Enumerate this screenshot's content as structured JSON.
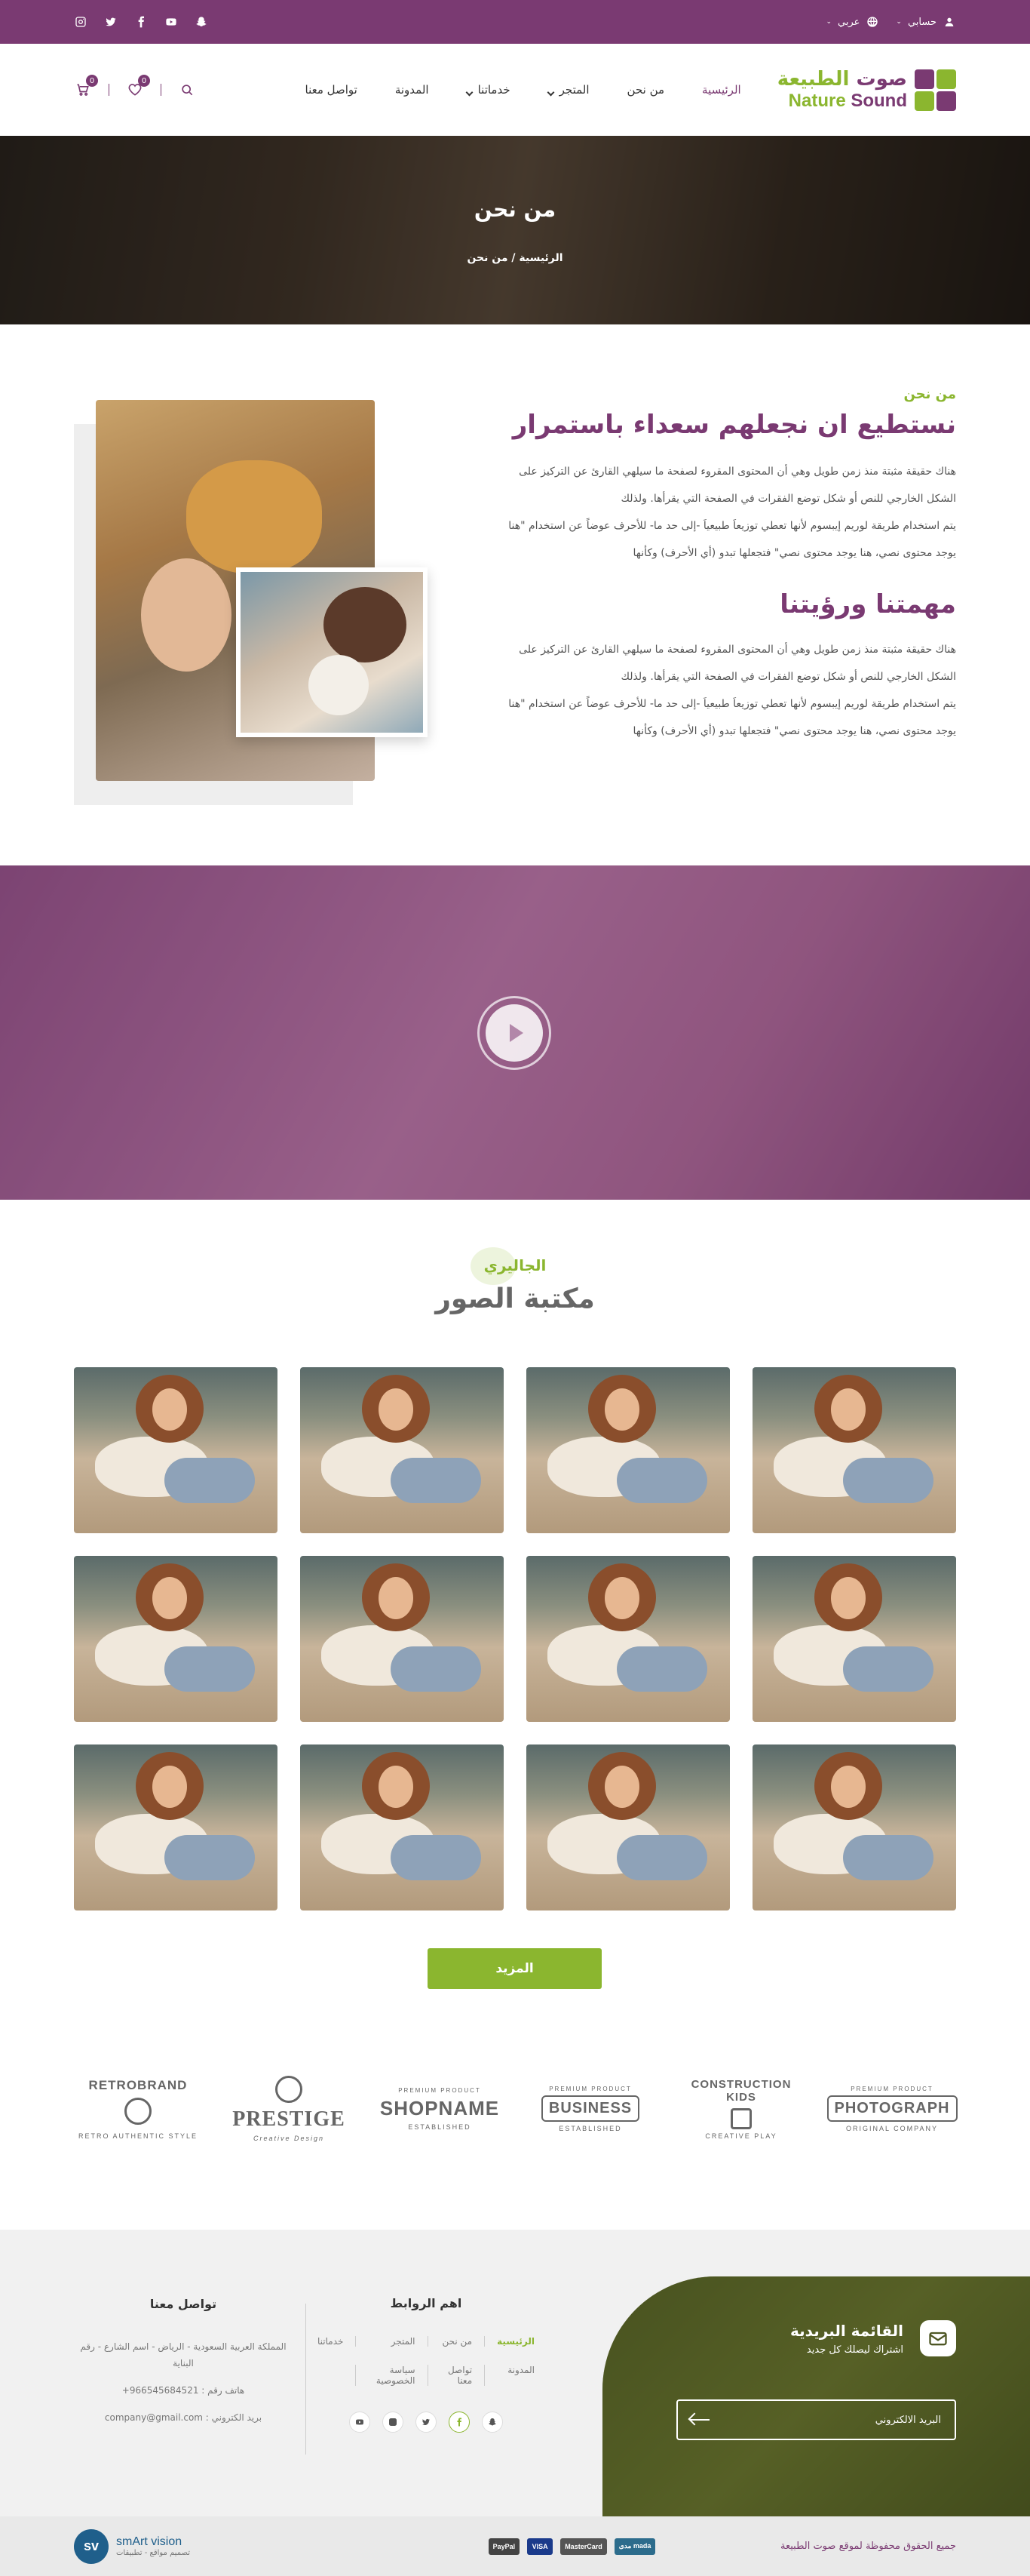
{
  "topbar": {
    "account_label": "حسابي",
    "language_label": "عربي",
    "socials": [
      "snapchat-icon",
      "youtube-icon",
      "facebook-icon",
      "twitter-icon",
      "instagram-icon"
    ]
  },
  "header": {
    "logo_ar_part1": "صوت",
    "logo_ar_part2": "الطبيعة",
    "logo_en_part1": "Nature",
    "logo_en_part2": "Sound",
    "nav": [
      {
        "label": "الرئيسية"
      },
      {
        "label": "من نحن"
      },
      {
        "label": "المتجر"
      },
      {
        "label": "خدماتنا"
      },
      {
        "label": "المدونة"
      },
      {
        "label": "تواصل معنا"
      }
    ],
    "wishlist_count": "0",
    "cart_count": "0"
  },
  "hero": {
    "title": "من نحن",
    "breadcrumb": "الرئيسية / من نحن"
  },
  "about": {
    "eyebrow": "من نحن",
    "heading": "نستطيع ان نجعلهم سعداء باستمرار",
    "para1_line1": "هناك حقيقة مثبتة منذ زمن طويل وهي أن المحتوى المقروء لصفحة ما سيلهي القارئ عن التركيز على",
    "para1_line2": "الشكل الخارجي للنص أو شكل توضع الفقرات في الصفحة التي يقرأها. ولذلك",
    "para1_line3": "يتم استخدام طريقة لوريم إيبسوم لأنها تعطي توزيعاَ طبيعياَ -إلى حد ما- للأحرف عوضاً عن استخدام \"هنا",
    "para1_line4": "يوجد محتوى نصي، هنا يوجد محتوى نصي\" فتجعلها تبدو (أي الأحرف) وكأنها",
    "heading2": "مهمتنا ورؤيتنا",
    "para2_line1": "هناك حقيقة مثبتة منذ زمن طويل وهي أن المحتوى المقروء لصفحة ما سيلهي القارئ عن التركيز على",
    "para2_line2": "الشكل الخارجي للنص أو شكل توضع الفقرات في الصفحة التي يقرأها. ولذلك",
    "para2_line3": "يتم استخدام طريقة لوريم إيبسوم لأنها تعطي توزيعاَ طبيعياَ -إلى حد ما- للأحرف عوضاً عن استخدام \"هنا",
    "para2_line4": "يوجد محتوى نصي، هنا يوجد محتوى نصي\" فتجعلها تبدو (أي الأحرف) وكأنها"
  },
  "gallery": {
    "eyebrow": "الجاليري",
    "title": "مكتبة الصور",
    "more_button": "المزيد"
  },
  "brands": [
    {
      "top": "PREMIUM PRODUCT",
      "main": "PHOTOGRAPH",
      "sub": "ORIGINAL COMPANY"
    },
    {
      "top": "",
      "main": "CONSTRUCTION KIDS",
      "sub": "CREATIVE PLAY"
    },
    {
      "top": "PREMIUM PRODUCT",
      "main": "BUSINESS",
      "sub": "ESTABLISHED"
    },
    {
      "top": "PREMIUM PRODUCT",
      "main": "SHOPNAME",
      "sub": "ESTABLISHED"
    },
    {
      "top": "",
      "main": "PRESTIGE",
      "sub": "Creative Design"
    },
    {
      "top": "",
      "main": "RETROBRAND",
      "sub": "RETRO AUTHENTIC STYLE"
    }
  ],
  "footer": {
    "newsletter_title": "القائمة البريدية",
    "newsletter_sub": "اشتراك ليصلك كل جديد",
    "email_placeholder": "البريد الالكتروني",
    "links_title": "اهم الروابط",
    "links": [
      {
        "label": "الرئيسية"
      },
      {
        "label": "من نحن"
      },
      {
        "label": "المتجر"
      },
      {
        "label": "خدماتنا"
      },
      {
        "label": "المدونة"
      },
      {
        "label": "تواصل معنا"
      },
      {
        "label": "سياسة الخصوصية"
      }
    ],
    "contact_title": "تواصل معنا",
    "address": "المملكة العربية السعودية - الرياض - اسم الشارع - رقم البناية",
    "phone": "هاتف رقم : 966545684521+",
    "email": "بريد الكتروني : company@gmail.com"
  },
  "bottom": {
    "copyright": "جميع الحقوق محفوظة لموقع صوت الطبيعة",
    "payments": [
      "مدى mada",
      "MasterCard",
      "VISA",
      "PayPal"
    ],
    "dev_logo": "sv",
    "dev_name": "smArt vision",
    "dev_tag": "تصميم مواقع - تطبيقات"
  },
  "colors": {
    "primary": "#7a3a72",
    "accent": "#8bb62f"
  }
}
